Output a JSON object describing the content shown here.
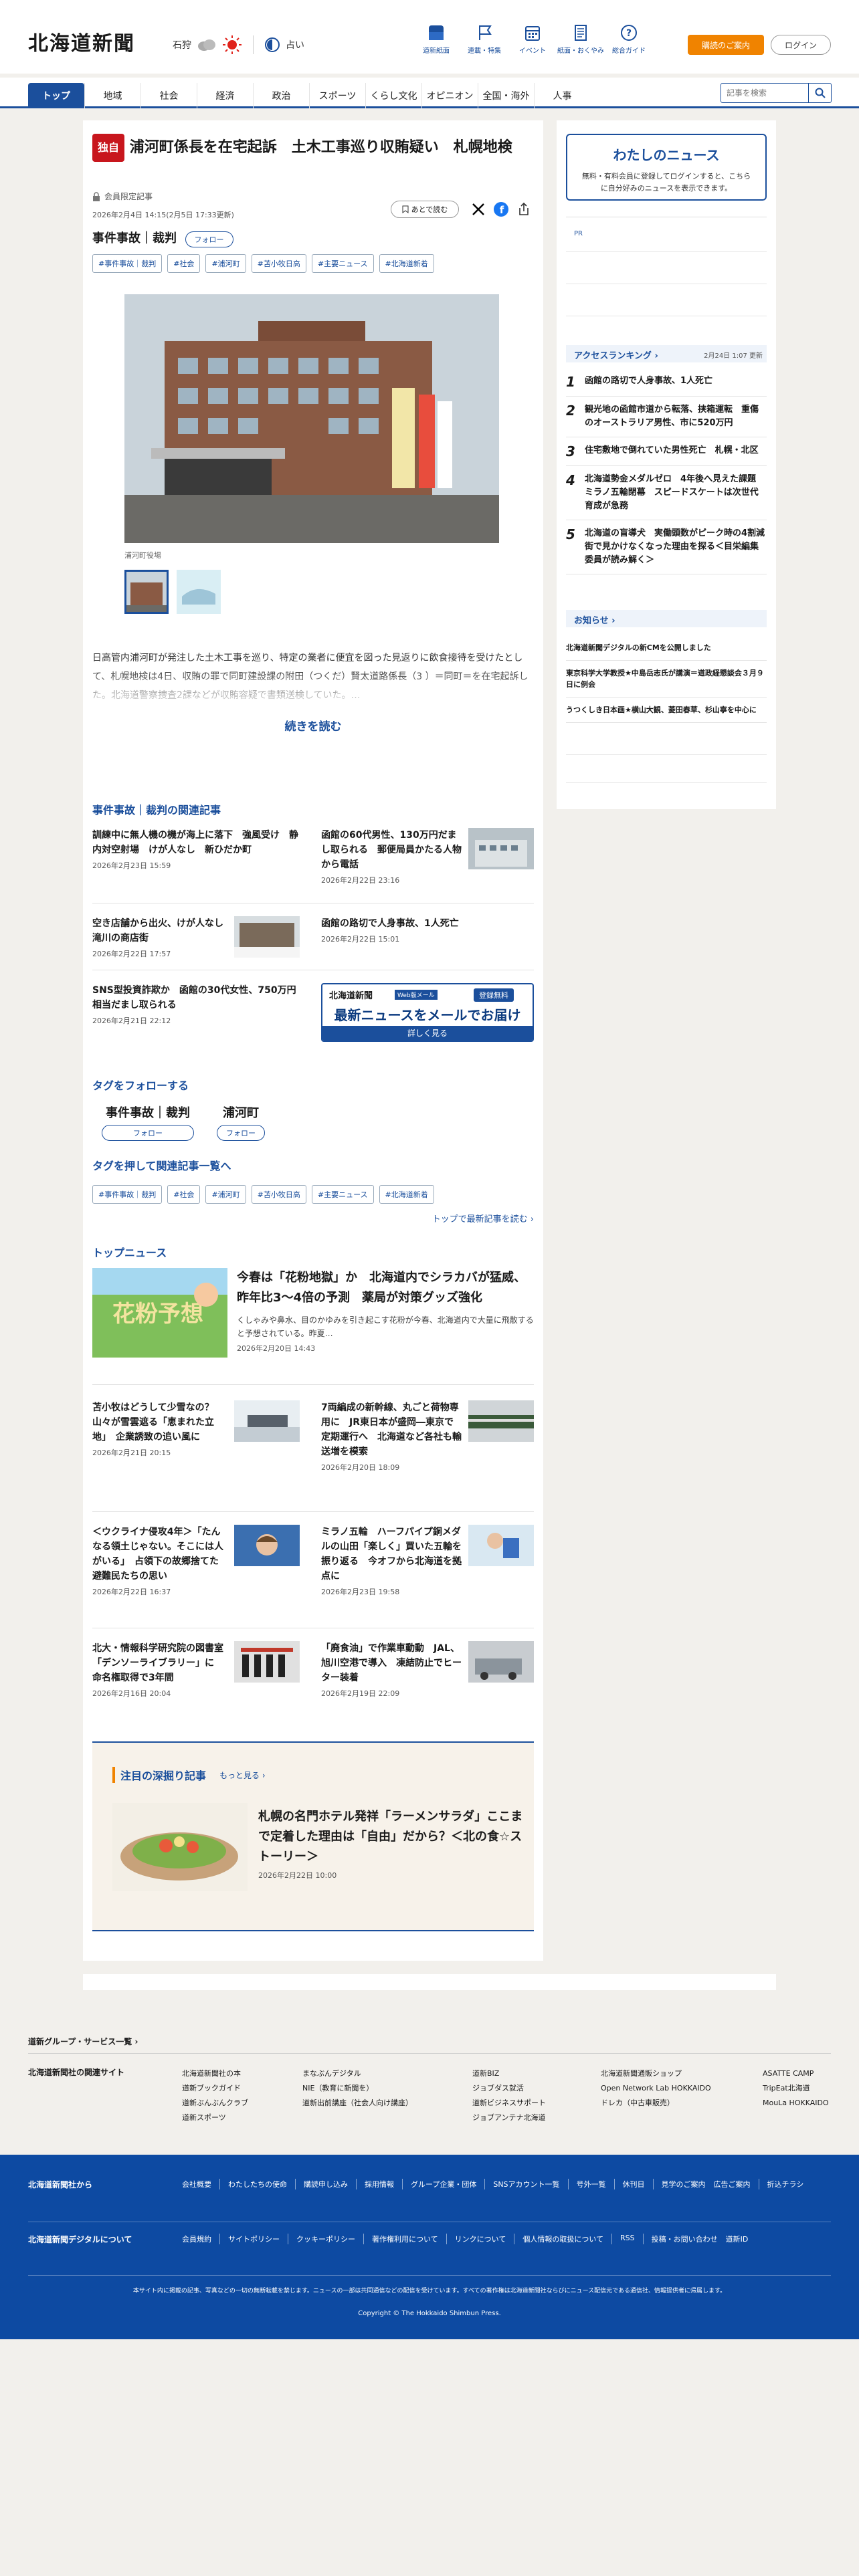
{
  "header": {
    "logo": "北海道新聞",
    "weather": {
      "location": "石狩",
      "label": "占い"
    },
    "icons": [
      {
        "name": "電子版-icon",
        "label": "道新紙面"
      },
      {
        "name": "flag-icon",
        "label": "連載・特集"
      },
      {
        "name": "calendar-icon",
        "label": "イベント"
      },
      {
        "name": "paper-icon",
        "label": "紙面・おくやみ"
      },
      {
        "name": "help-icon",
        "label": "総合ガイド"
      }
    ],
    "subscribe": "購読のご案内",
    "login": "ログイン"
  },
  "nav": {
    "tabs": [
      "トップ",
      "地域",
      "社会",
      "経済",
      "政治",
      "スポーツ",
      "くらし文化",
      "オピニオン",
      "全国・海外",
      "人事"
    ],
    "search_placeholder": "記事を検索"
  },
  "article": {
    "badge": "独自",
    "title": "浦河町係長を在宅起訴　土木工事巡り収賄疑い　札幌地検",
    "member": "会員限定記事",
    "date": "2026年2月4日 14:15(2月5日 17:33更新)",
    "later": "あとで読む",
    "category": "事件事故｜裁判",
    "follow": "フォロー",
    "tags": [
      "#事件事故｜裁判",
      "#社会",
      "#浦河町",
      "#苫小牧日高",
      "#主要ニュース",
      "#北海道新着"
    ],
    "photo_caption": "浦河町役場",
    "lead": "日高管内浦河町が発注した土木工事を巡り、特定の業者に便宜を図った見返りに飲食接待を受けたとして、札幌地検は4日、収賄の罪で同町建設課の附田（つくだ）賢太道路係長（3        ）＝同町＝を在宅起訴した。北海道警察捜査2課などが収賄容疑で書類送検していた。…",
    "read_more": "続きを読む"
  },
  "related": {
    "heading": "事件事故｜裁判の関連記事",
    "items": [
      {
        "title": "訓練中に無人機の機が海上に落下　強風受け　静内対空射場　けが人なし　新ひだか町",
        "date": "2026年2月23日 15:59"
      },
      {
        "title": "函館の60代男性、130万円だまし取られる　郵便局員かたる人物から電話",
        "date": "2026年2月22日 23:16"
      },
      {
        "title": "空き店舗から出火、けが人なし　滝川の商店街",
        "date": "2026年2月22日 17:57"
      },
      {
        "title": "函館の路切で人身事故、1人死亡",
        "date": "2026年2月22日 15:01"
      },
      {
        "title": "SNS型投資詐欺か　函館の30代女性、750万円相当だまし取られる",
        "date": "2026年2月21日 22:12"
      }
    ],
    "ad": {
      "logo": "北海道新聞",
      "tag": "Web版メール",
      "reg": "登録無料",
      "main": "最新ニュースをメールでお届け",
      "sub": "詳しく見る"
    }
  },
  "follow_tags": {
    "heading": "タグをフォローする",
    "items": [
      {
        "label": "事件事故｜裁判",
        "btn": "フォロー"
      },
      {
        "label": "浦河町",
        "btn": "フォロー"
      }
    ]
  },
  "tag_list": {
    "heading": "タグを押して関連記事一覧へ",
    "link": "トップで最新記事を読む"
  },
  "top_news": {
    "heading": "トップニュース",
    "featured": {
      "title": "今春は「花粉地獄」か　北海道内でシラカバが猛威、昨年比3～4倍の予測　薬局が対策グッズ強化",
      "summary": "くしゃみや鼻水、目のかゆみを引き起こす花粉が今春、北海道内で大量に飛散すると予想されている。昨夏…",
      "date": "2026年2月20日 14:43",
      "img_text": "花粉予想"
    },
    "items": [
      {
        "title": "苫小牧はどうして少雪なの？　山々が雪雲遮る「恵まれた立地」　企業誘致の追い風に",
        "date": "2026年2月21日 20:15"
      },
      {
        "title": "7両編成の新幹線、丸ごと荷物専用に　JR東日本が盛岡―東京で定期運行へ　北海道など各社も輸送増を模索",
        "date": "2026年2月20日 18:09"
      },
      {
        "title": "＜ウクライナ侵攻4年＞「たんなる領土じゃない。そこには人がいる」　占領下の故郷捨てた避難民たちの思い",
        "date": "2026年2月22日 16:37"
      },
      {
        "title": "ミラノ五輪　ハーフパイプ銅メダルの山田「楽しく」買いた五輪を振り返る　今オフから北海道を拠点に",
        "date": "2026年2月23日 19:58"
      },
      {
        "title": "北大・情報科学研究院の図書室「デンソーライブラリー」に　命名権取得で3年間",
        "date": "2026年2月16日 20:04"
      },
      {
        "title": "「廃食油」で作業車動動　JAL、旭川空港で導入　凍結防止でヒーター装着",
        "date": "2026年2月19日 22:09"
      }
    ]
  },
  "deep": {
    "heading": "注目の深掘り記事",
    "more": "もっと見る",
    "title": "札幌の名門ホテル発祥「ラーメンサラダ」ここまで定着した理由は「自由」だから？＜北の食☆ストーリー＞",
    "date": "2026年2月22日 10:00"
  },
  "sidebar": {
    "my_news": {
      "title": "わたしのニュース",
      "desc": "無料・有料会員に登録してログインすると、こちらに自分好みのニュースを表示できます。"
    },
    "pr": "PR",
    "ranking": {
      "heading": "アクセスランキング",
      "updated": "2月24日 1:07 更新",
      "items": [
        "函館の路切で人身事故、1人死亡",
        "観光地の函館市道から転落、挟箱運転　重傷のオーストラリア男性、市に520万円",
        "住宅敷地で倒れていた男性死亡　札幌・北区",
        "北海道勢金メダルゼロ　4年後へ見えた課題　ミラノ五輪閉幕　スピードスケートは次世代育成が急務",
        "北海道の盲導犬　実働頭数がピーク時の4割減　街で見かけなくなった理由を探る＜目栄編集委員が読み解く＞"
      ]
    },
    "info": {
      "heading": "お知らせ",
      "items": [
        "北海道新聞デジタルの新CMを公開しました",
        "東京科学大学教授★中島岳志氏が講演＝道政経懇談会３月９日に例会",
        "うつくしき日本画★横山大観、菱田春草、杉山寧を中心に"
      ]
    }
  },
  "footer": {
    "group": "道新グループ・サービス一覧",
    "related_heading": "北海道新聞社の関連サイト",
    "related": [
      [
        "北海道新聞社の本",
        "道新ブックガイド",
        "道新ぶんぶんクラブ",
        "道新スポーツ"
      ],
      [
        "まなぶんデジタル",
        "NIE（教育に新聞を）",
        "道新出前講座（社会人向け講座）"
      ],
      [
        "道新BIZ",
        "ジョブダス就活",
        "道新ビジネスサポート",
        "ジョブアンテナ北海道"
      ],
      [
        "北海道新聞通販ショップ",
        "Open Network Lab HOKKAIDO",
        "ドレカ（中古車販売）"
      ],
      [
        "ASATTE CAMP",
        "TripEat北海道",
        "MouLa HOKKAIDO"
      ]
    ],
    "company_heading": "北海道新聞社から",
    "company": [
      "会社概要",
      "わたしたちの使命",
      "購読申し込み",
      "採用情報",
      "グループ企業・団体",
      "SNSアカウント一覧",
      "号外一覧",
      "休刊日",
      "見学のご案内",
      "広告ご案内",
      "折込チラシ"
    ],
    "digital_heading": "北海道新聞デジタルについて",
    "digital": [
      "会員規約",
      "サイトポリシー",
      "クッキーポリシー",
      "著作権利用について",
      "リンクについて",
      "個人情報の取扱について",
      "RSS",
      "投稿・お問い合わせ",
      "道新ID"
    ],
    "notice": "本サイト内に掲載の記事、写真などの一切の無断転載を禁じます。ニュースの一部は共同通信などの配信を受けています。すべての著作権は北海道新聞社ならびにニュース配信元である通信社、情報提供者に帰属します。",
    "copyright": "Copyright © The Hokkaido Shimbun Press."
  }
}
